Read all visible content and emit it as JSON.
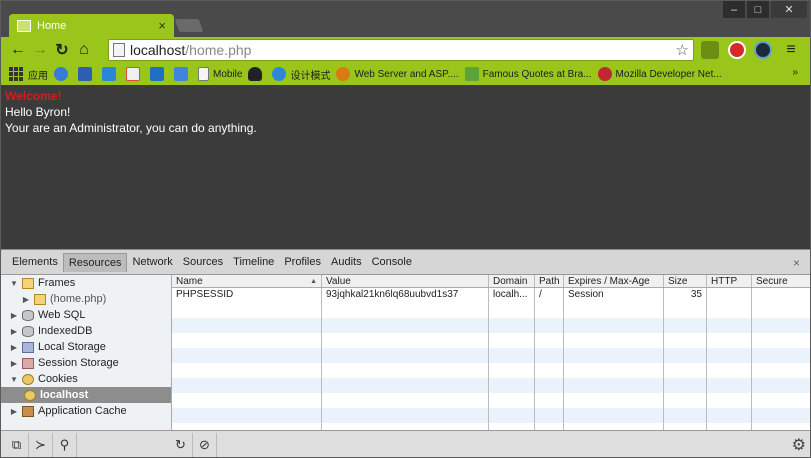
{
  "window": {
    "tab_title": "Home",
    "tab_close": "×",
    "controls": {
      "minimize": "–",
      "maximize": "□",
      "close": "✕"
    }
  },
  "toolbar": {
    "back": "←",
    "forward": "→",
    "reload": "↻",
    "home": "⌂",
    "url_host": "localhost",
    "url_path": "/home.php",
    "bookmark_star": "☆",
    "menu": "≡"
  },
  "bookmarks": {
    "items": [
      {
        "label": "应用",
        "icon": "apps-icon"
      },
      {
        "label": "",
        "icon": "blue-globe-icon",
        "color": "#3a7bd5"
      },
      {
        "label": "",
        "icon": "grid-icon",
        "color": "#2c5fb3"
      },
      {
        "label": "",
        "icon": "b-icon",
        "color": "#2a86d6"
      },
      {
        "label": "",
        "icon": "gmail-icon",
        "color": "#e04b3a"
      },
      {
        "label": "",
        "icon": "outlook-icon",
        "color": "#1f6fc2"
      },
      {
        "label": "",
        "icon": "translate-icon",
        "color": "#3f84e0"
      },
      {
        "label": "Mobile",
        "icon": "folder-icon",
        "color": "#f6f6f6"
      },
      {
        "label": "",
        "icon": "penguin-icon",
        "color": "#222222"
      },
      {
        "label": "设计模式",
        "icon": "globe-icon",
        "color": "#2f86d4"
      },
      {
        "label": "Web Server and ASP....",
        "icon": "asp-icon",
        "color": "#d97a14"
      },
      {
        "label": "Famous Quotes at Bra...",
        "icon": "quotes-icon",
        "color": "#5aa33b"
      },
      {
        "label": "Mozilla Developer Net...",
        "icon": "mozilla-icon",
        "color": "#c0282d"
      }
    ],
    "more": "»"
  },
  "page": {
    "welcome": "Welcome!",
    "greeting": "Hello Byron!",
    "message": "Your are an Administrator, you can do anything."
  },
  "devtools": {
    "tabs": [
      "Elements",
      "Resources",
      "Network",
      "Sources",
      "Timeline",
      "Profiles",
      "Audits",
      "Console"
    ],
    "active_tab": "Resources",
    "close": "×",
    "tree": [
      {
        "label": "Frames",
        "expanded": true,
        "level": 0,
        "icon": "folder-icon"
      },
      {
        "label": "(home.php)",
        "expanded": false,
        "level": 1,
        "icon": "folder-icon"
      },
      {
        "label": "Web SQL",
        "expanded": false,
        "level": 0,
        "icon": "database-icon"
      },
      {
        "label": "IndexedDB",
        "expanded": false,
        "level": 0,
        "icon": "database-icon"
      },
      {
        "label": "Local Storage",
        "expanded": false,
        "level": 0,
        "icon": "storage-grid-icon"
      },
      {
        "label": "Session Storage",
        "expanded": false,
        "level": 0,
        "icon": "storage-grid-icon"
      },
      {
        "label": "Cookies",
        "expanded": true,
        "level": 0,
        "icon": "cookie-icon"
      },
      {
        "label": "localhost",
        "expanded": null,
        "level": 1,
        "icon": "cookie-icon",
        "selected": true
      },
      {
        "label": "Application Cache",
        "expanded": false,
        "level": 0,
        "icon": "app-cache-icon"
      }
    ],
    "table": {
      "columns": [
        "Name",
        "Value",
        "Domain",
        "Path",
        "Expires / Max-Age",
        "Size",
        "HTTP",
        "Secure"
      ],
      "rows": [
        [
          "PHPSESSID",
          "93jqhkal21kn6lq68uubvd1s37",
          "localh...",
          "/",
          "Session",
          "35",
          "",
          ""
        ]
      ],
      "empty_rows": 9
    },
    "statusbar": {
      "dock": "⧉",
      "console": "≻",
      "search": "⚲",
      "refresh": "↻",
      "clear": "⊘",
      "settings": "⚙"
    }
  }
}
